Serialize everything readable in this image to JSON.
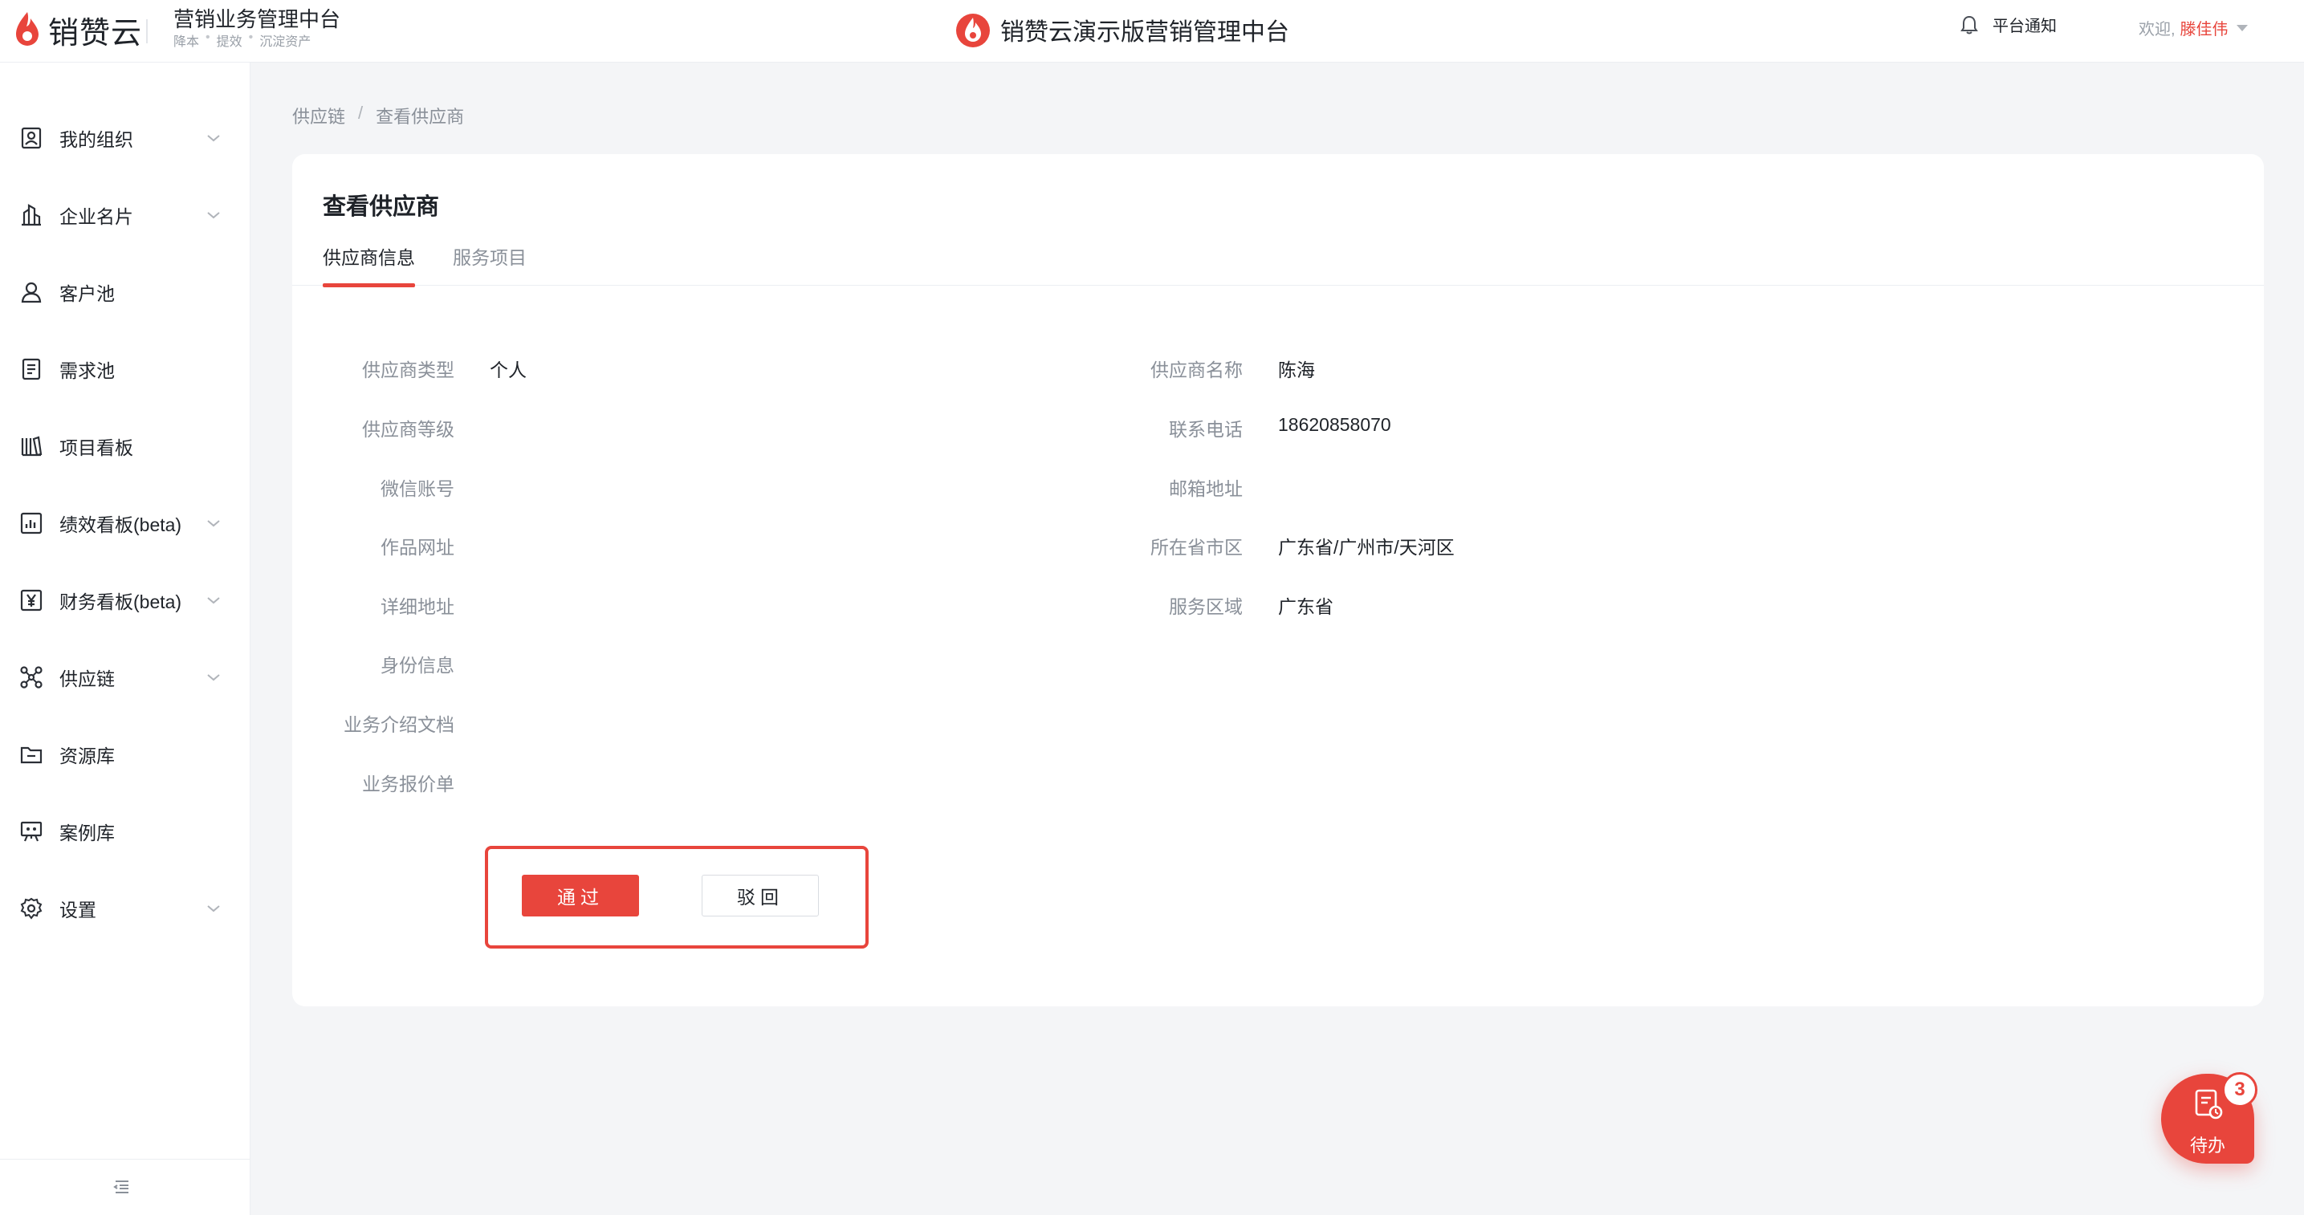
{
  "header": {
    "logo_text": "销赞云",
    "sub_title": "营销业务管理中台",
    "slogans": [
      "降本",
      "提效",
      "沉淀资产"
    ],
    "center_title": "销赞云演示版营销管理中台",
    "notice_label": "平台通知",
    "welcome_prefix": "欢迎,",
    "user_name": "滕佳伟"
  },
  "sidebar": {
    "items": [
      {
        "label": "我的组织",
        "icon": "org-icon",
        "expandable": true
      },
      {
        "label": "企业名片",
        "icon": "building-icon",
        "expandable": true
      },
      {
        "label": "客户池",
        "icon": "user-icon",
        "expandable": false
      },
      {
        "label": "需求池",
        "icon": "document-icon",
        "expandable": false
      },
      {
        "label": "项目看板",
        "icon": "books-icon",
        "expandable": false
      },
      {
        "label": "绩效看板(beta)",
        "icon": "chart-icon",
        "expandable": true
      },
      {
        "label": "财务看板(beta)",
        "icon": "yen-icon",
        "expandable": true
      },
      {
        "label": "供应链",
        "icon": "network-icon",
        "expandable": true
      },
      {
        "label": "资源库",
        "icon": "folder-icon",
        "expandable": false
      },
      {
        "label": "案例库",
        "icon": "presentation-icon",
        "expandable": false
      },
      {
        "label": "设置",
        "icon": "gear-icon",
        "expandable": true
      }
    ]
  },
  "breadcrumb": {
    "parent": "供应链",
    "separator": "/",
    "current": "查看供应商"
  },
  "card": {
    "title": "查看供应商",
    "tabs": [
      {
        "label": "供应商信息",
        "active": true
      },
      {
        "label": "服务项目",
        "active": false
      }
    ],
    "left_fields": [
      {
        "label": "供应商类型",
        "value": "个人"
      },
      {
        "label": "供应商等级",
        "value": ""
      },
      {
        "label": "微信账号",
        "value": ""
      },
      {
        "label": "作品网址",
        "value": ""
      },
      {
        "label": "详细地址",
        "value": ""
      },
      {
        "label": "身份信息",
        "value": ""
      },
      {
        "label": "业务介绍文档",
        "value": ""
      },
      {
        "label": "业务报价单",
        "value": ""
      }
    ],
    "right_fields": [
      {
        "label": "供应商名称",
        "value": "陈海"
      },
      {
        "label": "联系电话",
        "value": "18620858070"
      },
      {
        "label": "邮箱地址",
        "value": ""
      },
      {
        "label": "所在省市区",
        "value": "广东省/广州市/天河区"
      },
      {
        "label": "服务区域",
        "value": "广东省"
      }
    ],
    "pass_label": "通过",
    "reject_label": "驳回"
  },
  "todo": {
    "label": "待办",
    "count": "3"
  },
  "colors": {
    "accent": "#e8453c",
    "text": "#1f2329",
    "muted": "#8a9099",
    "background": "#f4f5f7"
  }
}
